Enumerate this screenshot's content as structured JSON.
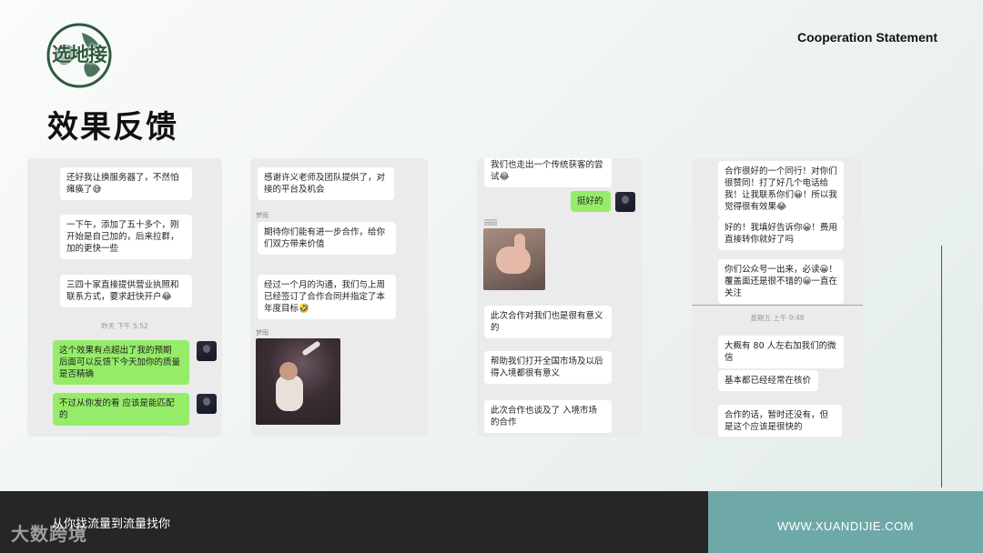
{
  "header": {
    "logo_text": "选地接",
    "statement": "Cooperation Statement",
    "title": "效果反馈"
  },
  "chat1": {
    "m1": "还好我让换服务器了，不然怕瘫痪了😅",
    "m2": "一下午，添加了五十多个，刚开始是自己加的，后来拉群，加的更快一些",
    "m3": "三四十家直接提供营业执照和联系方式，要求赶快开户😂",
    "timestamp": "昨天 下午 5:52",
    "m4": "这个效果有点超出了我的预期 后面可以反馈下今天加你的质量 是否精确",
    "m5": "不过从你发的看 应该是能匹配的"
  },
  "chat2": {
    "m1": "感谢许义老师及团队提供了，对接的平台及机会",
    "name1": "梦雨",
    "m2": "期待你们能有进一步合作，给你们双方带来价值",
    "m3": "经过一个月的沟通，我们与上周已经签订了合作合同并指定了本年度目标🤣",
    "name2": "梦雨"
  },
  "chat3": {
    "m1": "我们也走出一个传统获客的尝试😂",
    "m2": "挺好的",
    "name1": "园园",
    "m3": "此次合作对我们也是很有意义的",
    "m4": "帮助我们打开全国市场及以后得入境都很有意义",
    "m5": "此次合作也谈及了 入境市场的合作"
  },
  "chat4": {
    "m1": "合作很好的一个同行！对你们很赞同！打了好几个电话给我！让我联系你们😀！所以我觉得很有效果😂",
    "m2": "好的！我填好告诉你😀！费用直接转你就好了吗",
    "m3": "你们公众号一出来，必读😀！覆盖面还是很不错的😀一直在关注",
    "timestamp": "星期五 上午 9:48",
    "m4": "大概有 80 人左右加我们的微信",
    "m5": "基本都已经经常在核价",
    "m6": "合作的话，暂时还没有，但是这个应该是很快的"
  },
  "footer": {
    "slogan": "从你找流量到流量找你",
    "url": "WWW.XUANDIJIE.COM",
    "watermark": "大数跨境"
  },
  "colors": {
    "accent": "#6fa9a7",
    "footer_dark": "#262626",
    "bubble_green": "#95ec69",
    "logo_green": "#2f5a3e"
  }
}
